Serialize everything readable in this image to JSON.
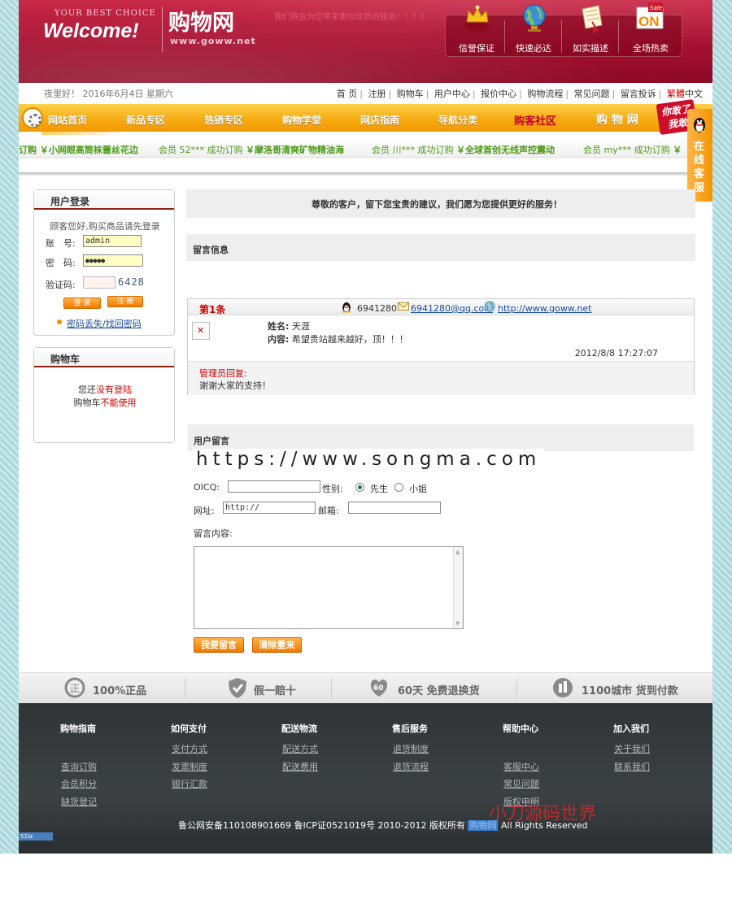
{
  "header": {
    "best_choice": "YOUR BEST CHOICE",
    "welcome": "Welcome!",
    "site_name": "购物网",
    "site_url": "www.goww.net",
    "slogan": "我们将会为您带来更加优质的服务！！！！",
    "badges": [
      {
        "label": "信誉保证",
        "icon": "crown-icon"
      },
      {
        "label": "快速必达",
        "icon": "globe-icon"
      },
      {
        "label": "如实描述",
        "icon": "scroll-icon"
      },
      {
        "label": "全场热卖",
        "icon": "sale-on-icon",
        "icon_text": "ON",
        "icon_small": "Sale"
      }
    ]
  },
  "topbar": {
    "greeting": "夜里好！ 2016年6月4日 星期六",
    "links": [
      "首 页",
      "注册",
      "购物车",
      "用户中心",
      "报价中心",
      "购物流程",
      "常见问题",
      "留言投诉"
    ],
    "lang_red": "繁體",
    "lang_other": "中文"
  },
  "nav": {
    "items": [
      "网站首页",
      "新品专区",
      "热销专区",
      "购物学堂",
      "网店指南",
      "导航分类",
      "购客社区",
      "购 物 网"
    ],
    "sale_tag": "你敢了我敢"
  },
  "ticker": [
    {
      "member": "",
      "product": "订购 ￥小网眼高筒袜蕾丝花边"
    },
    {
      "member": "会员 52*** 成功订购",
      "product": "￥摩洛哥清爽矿物精油海"
    },
    {
      "member": "会员 川*** 成功订购",
      "product": "￥全球首创无线声控震动"
    },
    {
      "member": "会员 my*** 成功订购",
      "product": "￥"
    }
  ],
  "online_service": {
    "label": "在线客服"
  },
  "login": {
    "title": "用户登录",
    "tip": "顾客您好,购买商品请先登录",
    "account_label": "账　号:",
    "account_value": "admin",
    "password_label": "密　码:",
    "password_value": "●●●●●",
    "captcha_label": "验证码:",
    "captcha_value": "",
    "captcha_code": "6428",
    "login_btn": "登 录",
    "register_btn": "注 册",
    "lost_password": "密码丢失/找回密码"
  },
  "cart": {
    "title": "购物车",
    "line1_a": "您还",
    "line1_b": "没有登陆",
    "line2_a": "购物车",
    "line2_b": "不能使用"
  },
  "main": {
    "notice": "尊敬的客户，留下您宝贵的建议，我们愿为您提供更好的服务！",
    "section_title": "留言信息",
    "message": {
      "number": "第1条",
      "qq": "6941280",
      "email": "6941280@qq.com",
      "url": "http://www.goww.net",
      "name_label": "姓名:",
      "name": "天涯",
      "content_label": "内容:",
      "content": "希望贵站越来越好，顶！！！",
      "time": "2012/8/8 17:27:07",
      "reply_title": "管理员回复:",
      "reply": "谢谢大家的支持！"
    },
    "form": {
      "title": "用户留言",
      "watermark": "https://www.songma.com",
      "oicq_label": "OICQ:",
      "oicq_value": "",
      "gender_label": "性别:",
      "gender_male": "先生",
      "gender_female": "小姐",
      "url_label": "网址:",
      "url_value": "http://",
      "email_label": "邮箱:",
      "email_value": "",
      "content_label": "留言内容:",
      "submit": "我要留言",
      "reset": "清除重来"
    }
  },
  "guarantees": [
    "100%正品",
    "假一赔十",
    "60天 免费退换货",
    "1100城市 货到付款"
  ],
  "footer": {
    "columns": [
      {
        "title": "购物指南",
        "links": [
          "",
          "查询订购",
          "会员积分",
          "缺货登记"
        ]
      },
      {
        "title": "如何支付",
        "links": [
          "支付方式",
          "发票制度",
          "银行汇款"
        ]
      },
      {
        "title": "配送物流",
        "links": [
          "配送方式",
          "配送费用"
        ]
      },
      {
        "title": "售后服务",
        "links": [
          "退货制度",
          "退货流程"
        ]
      },
      {
        "title": "帮助中心",
        "links": [
          "",
          "客服中心",
          "常见问题",
          "版权申明"
        ]
      },
      {
        "title": "加入我们",
        "links": [
          "关于我们",
          "联系我们",
          "",
          ""
        ]
      }
    ],
    "copyright_a": "鲁公网安备110108901669  鲁ICP证0521019号  2010-2012 版权所有",
    "copyright_link": "购物网",
    "copyright_b": "All Rights Reserved",
    "watermark": "小刀源码世界",
    "badge_51la": "51la"
  }
}
